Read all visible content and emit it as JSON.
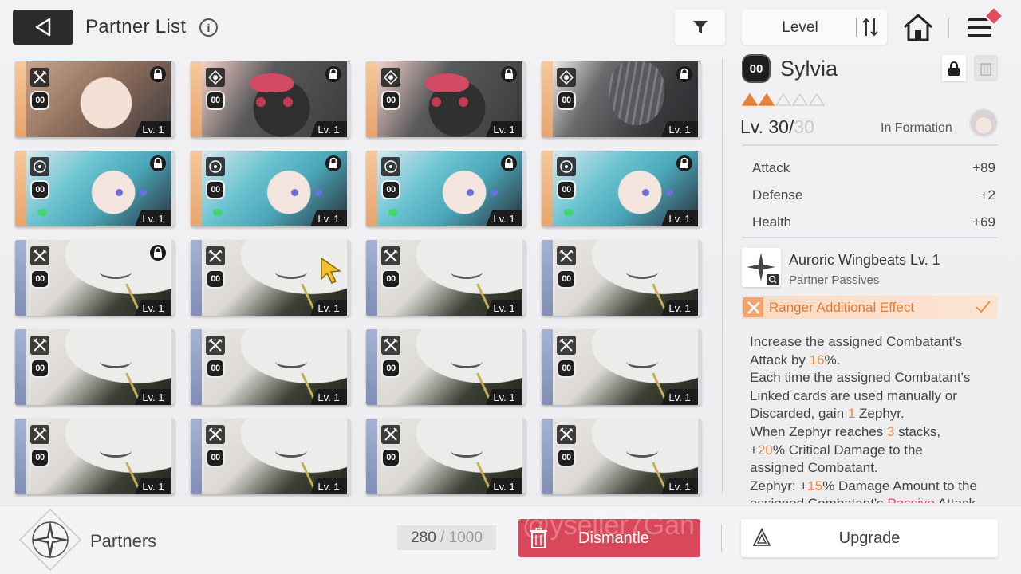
{
  "header": {
    "title": "Partner List",
    "info_glyph": "i",
    "sort": {
      "label": "Level"
    }
  },
  "grid": {
    "cards": [
      {
        "art": "girl",
        "rarity": "gold",
        "class_icon": "sword-cross-icon",
        "slot": "00",
        "locked": true,
        "level": "Lv. 1"
      },
      {
        "art": "bunny",
        "rarity": "gold",
        "class_icon": "target-icon",
        "slot": "00",
        "locked": true,
        "level": "Lv. 1"
      },
      {
        "art": "bunny",
        "rarity": "gold",
        "class_icon": "target-icon",
        "slot": "00",
        "locked": true,
        "level": "Lv. 1"
      },
      {
        "art": "bird",
        "rarity": "gold",
        "class_icon": "target-icon",
        "slot": "00",
        "locked": true,
        "level": "Lv. 1"
      },
      {
        "art": "teal",
        "rarity": "gold",
        "class_icon": "ring-icon",
        "slot": "00",
        "locked": true,
        "level": "Lv. 1"
      },
      {
        "art": "teal",
        "rarity": "gold",
        "class_icon": "ring-icon",
        "slot": "00",
        "locked": true,
        "level": "Lv. 1"
      },
      {
        "art": "teal",
        "rarity": "gold",
        "class_icon": "ring-icon",
        "slot": "00",
        "locked": true,
        "level": "Lv. 1"
      },
      {
        "art": "teal",
        "rarity": "gold",
        "class_icon": "ring-icon",
        "slot": "00",
        "locked": true,
        "level": "Lv. 1"
      },
      {
        "art": "mask",
        "rarity": "blue",
        "class_icon": "sword-cross-icon",
        "slot": "00",
        "locked": true,
        "level": "Lv. 1"
      },
      {
        "art": "mask",
        "rarity": "blue",
        "class_icon": "sword-cross-icon",
        "slot": "00",
        "locked": false,
        "level": "Lv. 1"
      },
      {
        "art": "mask",
        "rarity": "blue",
        "class_icon": "sword-cross-icon",
        "slot": "00",
        "locked": false,
        "level": "Lv. 1"
      },
      {
        "art": "mask",
        "rarity": "blue",
        "class_icon": "sword-cross-icon",
        "slot": "00",
        "locked": false,
        "level": "Lv. 1"
      },
      {
        "art": "mask",
        "rarity": "blue",
        "class_icon": "sword-cross-icon",
        "slot": "00",
        "locked": false,
        "level": "Lv. 1"
      },
      {
        "art": "mask",
        "rarity": "blue",
        "class_icon": "sword-cross-icon",
        "slot": "00",
        "locked": false,
        "level": "Lv. 1"
      },
      {
        "art": "mask",
        "rarity": "blue",
        "class_icon": "sword-cross-icon",
        "slot": "00",
        "locked": false,
        "level": "Lv. 1"
      },
      {
        "art": "mask",
        "rarity": "blue",
        "class_icon": "sword-cross-icon",
        "slot": "00",
        "locked": false,
        "level": "Lv. 1"
      },
      {
        "art": "mask",
        "rarity": "blue",
        "class_icon": "sword-cross-icon",
        "slot": "00",
        "locked": false,
        "level": "Lv. 1"
      },
      {
        "art": "mask",
        "rarity": "blue",
        "class_icon": "sword-cross-icon",
        "slot": "00",
        "locked": false,
        "level": "Lv. 1"
      },
      {
        "art": "mask",
        "rarity": "blue",
        "class_icon": "sword-cross-icon",
        "slot": "00",
        "locked": false,
        "level": "Lv. 1"
      },
      {
        "art": "mask",
        "rarity": "blue",
        "class_icon": "sword-cross-icon",
        "slot": "00",
        "locked": false,
        "level": "Lv. 1"
      }
    ]
  },
  "detail": {
    "slot": "00",
    "name": "Sylvia",
    "stars_filled": 2,
    "stars_total": 5,
    "level_current": "Lv. 30/",
    "level_max": "30",
    "formation_status": "In Formation",
    "stats": [
      {
        "label": "Attack",
        "value": "+89"
      },
      {
        "label": "Defense",
        "value": "+2"
      },
      {
        "label": "Health",
        "value": "+69"
      }
    ],
    "passive": {
      "name": "Auroric Wingbeats Lv. 1",
      "type": "Partner Passives"
    },
    "effect": {
      "label": "Ranger Additional Effect"
    },
    "description": {
      "l1a": "Increase the assigned Combatant's",
      "l2a": "Attack by ",
      "l2b": "16",
      "l2c": "%.",
      "l3a": "Each time the assigned Combatant's",
      "l4a": "Linked cards are used manually or",
      "l5a": "Discarded, gain ",
      "l5b": "1",
      "l5c": " Zephyr.",
      "l6a": "When Zephyr reaches ",
      "l6b": "3",
      "l6c": " stacks,",
      "l7a": "+",
      "l7b": "20",
      "l7c": "% Critical Damage to the",
      "l8a": "assigned Combatant.",
      "l9a": "Zephyr: +",
      "l9b": "15",
      "l9c": "% Damage Amount to the",
      "l10a": "assigned Combatant's ",
      "l10b": "Passive",
      "l10c": " Attack"
    }
  },
  "footer": {
    "section_label": "Partners",
    "count_current": "280",
    "count_sep": " / ",
    "count_max": "1000",
    "dismantle_label": "Dismantle",
    "watermark": "@yseller7Gan",
    "upgrade_label": "Upgrade"
  },
  "colors": {
    "accent_red": "#d9485a",
    "highlight_orange": "#ea8a44",
    "rarity_gold": "#e8a46e",
    "rarity_blue": "#7f8fb5"
  }
}
